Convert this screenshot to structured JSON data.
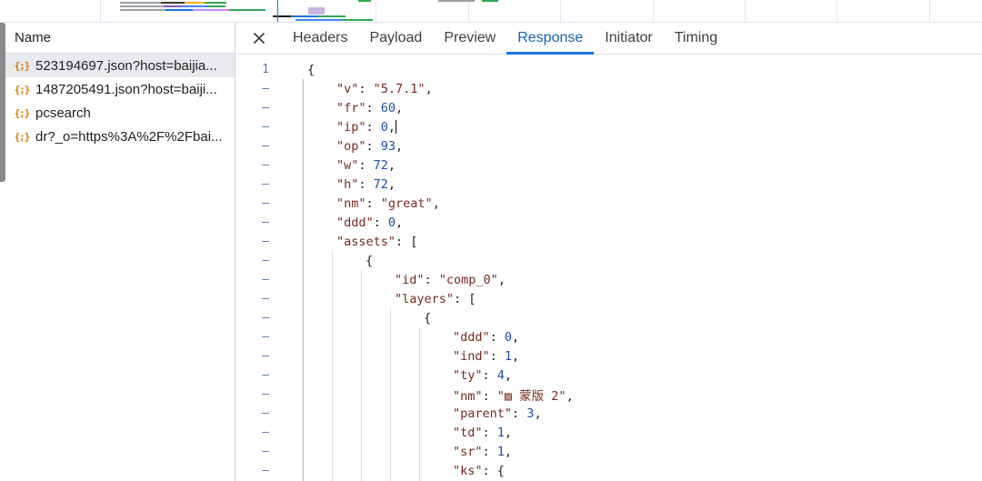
{
  "request_list": {
    "header": "Name",
    "requests": [
      {
        "name": "523194697.json?host=baijia...",
        "icon": "json-icon",
        "selected": true
      },
      {
        "name": "1487205491.json?host=baiji...",
        "icon": "json-icon",
        "selected": false
      },
      {
        "name": "pcsearch",
        "icon": "json-icon",
        "selected": false
      },
      {
        "name": "dr?_o=https%3A%2F%2Fbai...",
        "icon": "json-icon",
        "selected": false
      }
    ]
  },
  "details": {
    "close_icon": "close-icon",
    "tabs": [
      {
        "label": "Headers",
        "active": false
      },
      {
        "label": "Payload",
        "active": false
      },
      {
        "label": "Preview",
        "active": false
      },
      {
        "label": "Response",
        "active": true
      },
      {
        "label": "Initiator",
        "active": false
      },
      {
        "label": "Timing",
        "active": false
      }
    ]
  },
  "response": {
    "first_line_number": "1",
    "fold_marker": "–",
    "lines": [
      {
        "depth": 0,
        "tokens": [
          [
            "p",
            "{"
          ]
        ]
      },
      {
        "depth": 1,
        "tokens": [
          [
            "k",
            "\"v\""
          ],
          [
            "p",
            ": "
          ],
          [
            "s",
            "\"5.7.1\""
          ],
          [
            "p",
            ","
          ]
        ]
      },
      {
        "depth": 1,
        "tokens": [
          [
            "k",
            "\"fr\""
          ],
          [
            "p",
            ": "
          ],
          [
            "n",
            "60"
          ],
          [
            "p",
            ","
          ]
        ]
      },
      {
        "depth": 1,
        "tokens": [
          [
            "k",
            "\"ip\""
          ],
          [
            "p",
            ": "
          ],
          [
            "n",
            "0"
          ],
          [
            "p",
            ","
          ]
        ],
        "caret": true
      },
      {
        "depth": 1,
        "tokens": [
          [
            "k",
            "\"op\""
          ],
          [
            "p",
            ": "
          ],
          [
            "n",
            "93"
          ],
          [
            "p",
            ","
          ]
        ]
      },
      {
        "depth": 1,
        "tokens": [
          [
            "k",
            "\"w\""
          ],
          [
            "p",
            ": "
          ],
          [
            "n",
            "72"
          ],
          [
            "p",
            ","
          ]
        ]
      },
      {
        "depth": 1,
        "tokens": [
          [
            "k",
            "\"h\""
          ],
          [
            "p",
            ": "
          ],
          [
            "n",
            "72"
          ],
          [
            "p",
            ","
          ]
        ]
      },
      {
        "depth": 1,
        "tokens": [
          [
            "k",
            "\"nm\""
          ],
          [
            "p",
            ": "
          ],
          [
            "s",
            "\"great\""
          ],
          [
            "p",
            ","
          ]
        ]
      },
      {
        "depth": 1,
        "tokens": [
          [
            "k",
            "\"ddd\""
          ],
          [
            "p",
            ": "
          ],
          [
            "n",
            "0"
          ],
          [
            "p",
            ","
          ]
        ]
      },
      {
        "depth": 1,
        "tokens": [
          [
            "k",
            "\"assets\""
          ],
          [
            "p",
            ": ["
          ]
        ]
      },
      {
        "depth": 2,
        "tokens": [
          [
            "p",
            "{"
          ]
        ]
      },
      {
        "depth": 3,
        "tokens": [
          [
            "k",
            "\"id\""
          ],
          [
            "p",
            ": "
          ],
          [
            "s",
            "\"comp_0\""
          ],
          [
            "p",
            ","
          ]
        ]
      },
      {
        "depth": 3,
        "tokens": [
          [
            "k",
            "\"layers\""
          ],
          [
            "p",
            ": ["
          ]
        ]
      },
      {
        "depth": 4,
        "tokens": [
          [
            "p",
            "{"
          ]
        ]
      },
      {
        "depth": 5,
        "tokens": [
          [
            "k",
            "\"ddd\""
          ],
          [
            "p",
            ": "
          ],
          [
            "n",
            "0"
          ],
          [
            "p",
            ","
          ]
        ]
      },
      {
        "depth": 5,
        "tokens": [
          [
            "k",
            "\"ind\""
          ],
          [
            "p",
            ": "
          ],
          [
            "n",
            "1"
          ],
          [
            "p",
            ","
          ]
        ]
      },
      {
        "depth": 5,
        "tokens": [
          [
            "k",
            "\"ty\""
          ],
          [
            "p",
            ": "
          ],
          [
            "n",
            "4"
          ],
          [
            "p",
            ","
          ]
        ]
      },
      {
        "depth": 5,
        "tokens": [
          [
            "k",
            "\"nm\""
          ],
          [
            "p",
            ": "
          ],
          [
            "s",
            "\"▨ 蒙版 2\""
          ],
          [
            "p",
            ","
          ]
        ]
      },
      {
        "depth": 5,
        "tokens": [
          [
            "k",
            "\"parent\""
          ],
          [
            "p",
            ": "
          ],
          [
            "n",
            "3"
          ],
          [
            "p",
            ","
          ]
        ]
      },
      {
        "depth": 5,
        "tokens": [
          [
            "k",
            "\"td\""
          ],
          [
            "p",
            ": "
          ],
          [
            "n",
            "1"
          ],
          [
            "p",
            ","
          ]
        ]
      },
      {
        "depth": 5,
        "tokens": [
          [
            "k",
            "\"sr\""
          ],
          [
            "p",
            ": "
          ],
          [
            "n",
            "1"
          ],
          [
            "p",
            ","
          ]
        ]
      },
      {
        "depth": 5,
        "tokens": [
          [
            "k",
            "\"ks\""
          ],
          [
            "p",
            ": {"
          ]
        ]
      }
    ]
  },
  "colors": {
    "accent": "#1a73e8",
    "json_icon": "#e37400",
    "key_string": "#7a2a1e",
    "number": "#1b4fa8"
  }
}
